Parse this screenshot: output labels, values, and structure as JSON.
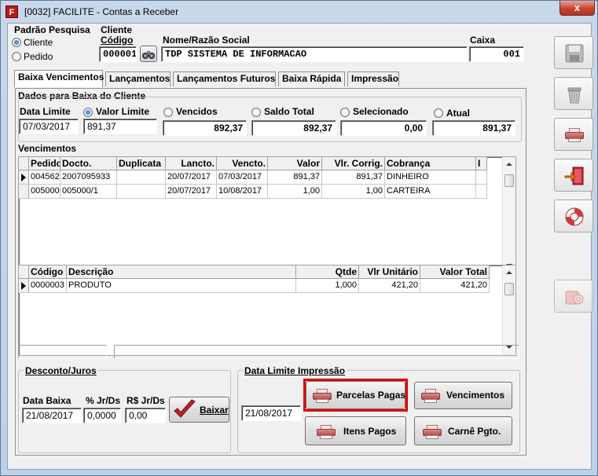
{
  "window": {
    "title": "[0032] FACILITE - Contas a Receber",
    "close_glyph": "x",
    "app_icon_letter": "F"
  },
  "padrao_pesquisa": {
    "title": "Padrão Pesquisa",
    "options": [
      "Cliente",
      "Pedido"
    ],
    "selected": "Cliente"
  },
  "cliente": {
    "title": "Cliente",
    "codigo_label": "Código",
    "codigo": "000001",
    "nome_label": "Nome/Razão Social",
    "nome": "TDP SISTEMA DE INFORMACAO",
    "caixa_label": "Caixa",
    "caixa": "001"
  },
  "tabs": [
    {
      "label": "Baixa Vencimentos",
      "active": true
    },
    {
      "label": "Lançamentos",
      "active": false
    },
    {
      "label": "Lançamentos Futuros",
      "active": false
    },
    {
      "label": "Baixa Rápida",
      "active": false
    },
    {
      "label": "Impressão",
      "active": false
    }
  ],
  "dados": {
    "title": "Dados para Baixa do Cliente",
    "data_limite_label": "Data Limite",
    "data_limite": "07/03/2017",
    "options": [
      {
        "label": "Valor Limite",
        "value": "891,37",
        "selected": true
      },
      {
        "label": "Vencidos",
        "value": "892,37",
        "selected": false
      },
      {
        "label": "Saldo Total",
        "value": "892,37",
        "selected": false
      },
      {
        "label": "Selecionado",
        "value": "0,00",
        "selected": false
      },
      {
        "label": "Atual",
        "value": "891,37",
        "selected": false
      }
    ]
  },
  "vencimentos": {
    "title": "Vencimentos",
    "columns": [
      "Pedido",
      "Docto.",
      "Duplicata",
      "Lancto.",
      "Vencto.",
      "Valor",
      "Vlr. Corrig.",
      "Cobrança",
      "I"
    ],
    "rows": [
      [
        "004562",
        "2007095933",
        "",
        "20/07/2017",
        "07/03/2017",
        "891,37",
        "891,37",
        "DINHEIRO",
        ""
      ],
      [
        "005000",
        "005000/1",
        "",
        "20/07/2017",
        "10/08/2017",
        "1,00",
        "1,00",
        "CARTEIRA",
        ""
      ]
    ]
  },
  "itens": {
    "columns": [
      "Código",
      "Descrição",
      "Qtde",
      "Vlr Unitário",
      "Valor Total"
    ],
    "rows": [
      [
        "0000003",
        "PRODUTO",
        "1,000",
        "421,20",
        "421,20"
      ]
    ]
  },
  "desconto": {
    "title": "Desconto/Juros",
    "data_baixa_label": "Data Baixa",
    "data_baixa": "21/08/2017",
    "pct_label": "% Jr/Ds",
    "pct": "0,0000",
    "rs_label": "R$ Jr/Ds",
    "rs": "0,00",
    "baixar_label": "Baixar"
  },
  "impressao": {
    "title": "Data Limite Impressão",
    "data": "21/08/2017",
    "buttons": [
      "Parcelas Pagas",
      "Vencimentos",
      "Itens Pagos",
      "Carnê Pgto."
    ]
  },
  "colors": {
    "highlight": "#e00000",
    "title_bar": "#c9d8ea"
  }
}
